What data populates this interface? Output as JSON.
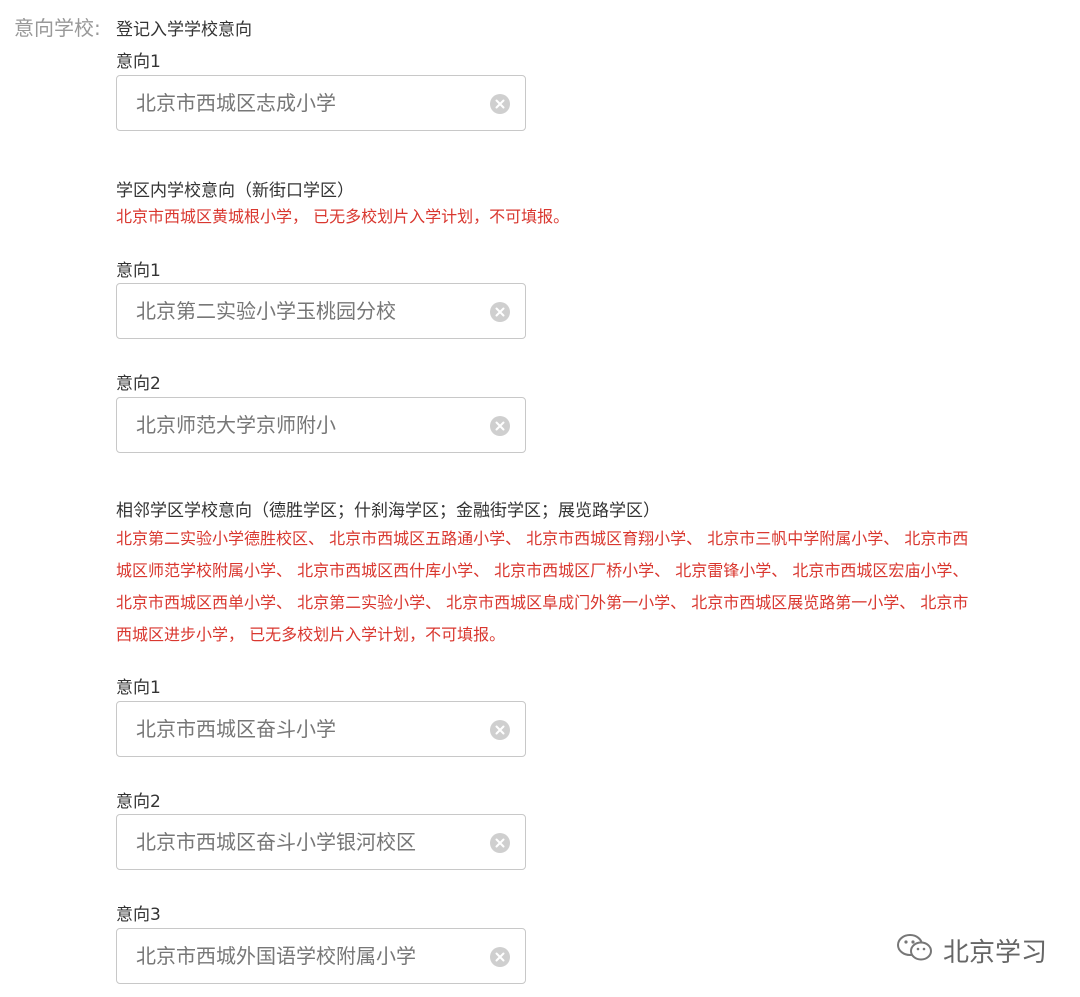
{
  "form": {
    "field_label": "意向学校:",
    "heading": "登记入学学校意向"
  },
  "registered": {
    "pref1_label": "意向1",
    "pref1_value": "北京市西城区志成小学"
  },
  "district": {
    "title": "学区内学校意向（新街口学区）",
    "warning": "北京市西城区黄城根小学， 已无多校划片入学计划，不可填报。",
    "pref1_label": "意向1",
    "pref1_value": "北京第二实验小学玉桃园分校",
    "pref2_label": "意向2",
    "pref2_value": "北京师范大学京师附小"
  },
  "neighbor": {
    "title": "相邻学区学校意向（德胜学区；什刹海学区；金融街学区；展览路学区）",
    "warning_lines": [
      "北京第二实验小学德胜校区、 北京市西城区五路通小学、 北京市西城区育翔小学、 北京市三帆中学附属小学、 北京市西",
      "城区师范学校附属小学、 北京市西城区西什库小学、 北京市西城区厂桥小学、 北京雷锋小学、 北京市西城区宏庙小学、",
      "北京市西城区西单小学、 北京第二实验小学、 北京市西城区阜成门外第一小学、 北京市西城区展览路第一小学、 北京市",
      "西城区进步小学， 已无多校划片入学计划，不可填报。"
    ],
    "pref1_label": "意向1",
    "pref1_value": "北京市西城区奋斗小学",
    "pref2_label": "意向2",
    "pref2_value": "北京市西城区奋斗小学银河校区",
    "pref3_label": "意向3",
    "pref3_value": "北京市西城外国语学校附属小学"
  },
  "watermark": {
    "text": "北京学习",
    "icon": "wechat-icon"
  },
  "colors": {
    "warning": "#d9372f",
    "label_gray": "#999999",
    "border": "#c8c8c8"
  }
}
